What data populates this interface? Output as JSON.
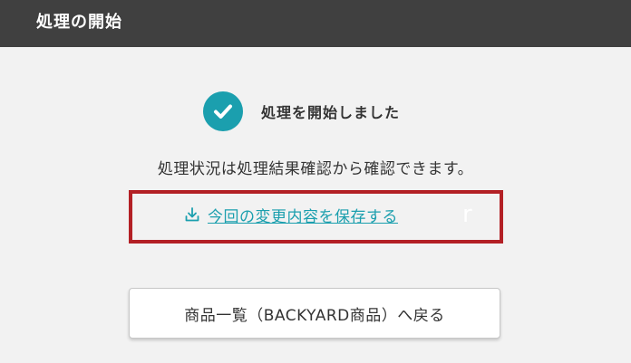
{
  "header": {
    "title": "処理の開始"
  },
  "result": {
    "done_text": "処理を開始しました",
    "status_text": "処理状況は処理結果確認から確認できます。",
    "save_link_label": "今回の変更内容を保存する",
    "cursor_text": "r"
  },
  "actions": {
    "back_button_label": "商品一覧（BACKYARD商品）へ戻る"
  },
  "colors": {
    "header_bg": "#404040",
    "accent": "#1b9fae",
    "highlight_border": "#b32025"
  },
  "icons": {
    "check": "check-circle-icon",
    "download": "download-icon"
  }
}
